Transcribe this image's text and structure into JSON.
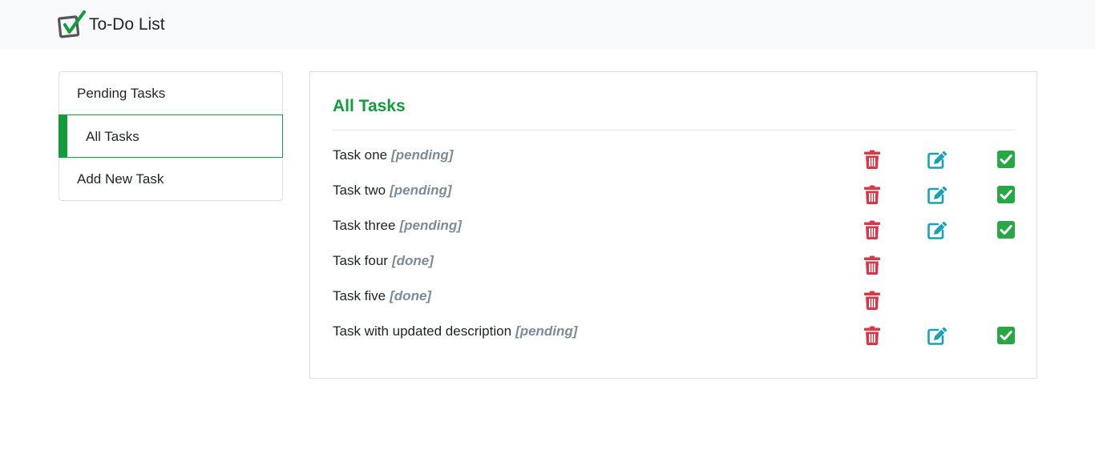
{
  "navbar": {
    "brand_text": "To-Do List",
    "logo_icon": "checkbox-check-logo-icon"
  },
  "sidebar": {
    "items": [
      {
        "label": "Pending Tasks",
        "active": false
      },
      {
        "label": "All Tasks",
        "active": true
      },
      {
        "label": "Add New Task",
        "active": false
      }
    ]
  },
  "main": {
    "title": "All Tasks",
    "tasks": [
      {
        "text": "Task one",
        "status": "[pending]",
        "actions": [
          "delete",
          "edit",
          "complete"
        ]
      },
      {
        "text": "Task two",
        "status": "[pending]",
        "actions": [
          "delete",
          "edit",
          "complete"
        ]
      },
      {
        "text": "Task three",
        "status": "[pending]",
        "actions": [
          "delete",
          "edit",
          "complete"
        ]
      },
      {
        "text": "Task four",
        "status": "[done]",
        "actions": [
          "delete"
        ]
      },
      {
        "text": "Task five",
        "status": "[done]",
        "actions": [
          "delete"
        ]
      },
      {
        "text": "Task with updated description",
        "status": "[pending]",
        "actions": [
          "delete",
          "edit",
          "complete"
        ]
      }
    ]
  },
  "colors": {
    "accent": "#109d3a",
    "delete": "#dc3545",
    "edit": "#17a2b8",
    "complete": "#28a745",
    "status_text": "#7d8b99"
  },
  "icons": {
    "delete": "trash-icon",
    "edit": "edit-icon",
    "complete": "check-square-icon"
  }
}
